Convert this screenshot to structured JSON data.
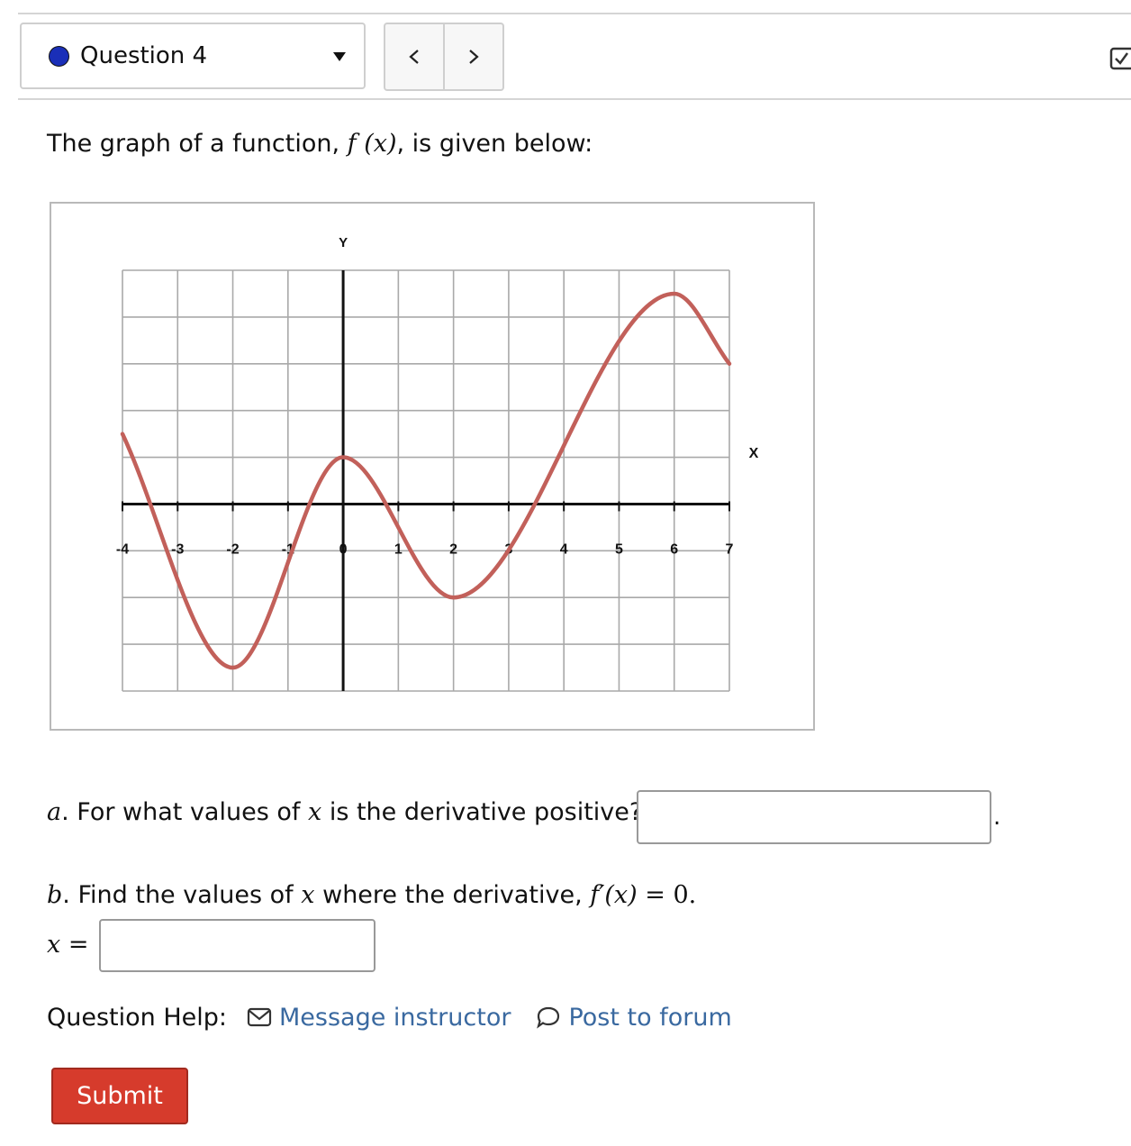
{
  "header": {
    "question_label": "Question 4",
    "status_dot_color": "#1a2fb8",
    "prev_symbol": "<",
    "next_symbol": ">",
    "corner_icon": "checkbox-arrow-icon"
  },
  "intro": {
    "text_before": "The graph of a function,",
    "function_notation": "f (x)",
    "text_after": ", is given below:"
  },
  "chart_data": {
    "type": "line",
    "x_axis_label": "X",
    "y_axis_label": "Y",
    "x_tick_labels": [
      "-4",
      "-3",
      "-2",
      "-1",
      "0",
      "1",
      "2",
      "3",
      "4",
      "5",
      "6",
      "7"
    ],
    "xlim": [
      -4,
      7
    ],
    "ylim": [
      -4,
      5
    ],
    "grid": true,
    "line_color": "#c2605a",
    "series": [
      {
        "x": [
          -4,
          -2,
          0,
          2,
          6,
          7
        ],
        "y": [
          1.5,
          -3.5,
          1,
          -2,
          4.5,
          3
        ]
      }
    ]
  },
  "part_a": {
    "letter": "a",
    "question": ". For what values of",
    "variable": "x",
    "question_end": "is the derivative positive?",
    "input_value": "",
    "trailing_punct": "."
  },
  "part_b": {
    "letter": "b",
    "question": ". Find the values of",
    "variable": "x",
    "question_mid": "where the derivative,",
    "derivative": "f′(x)",
    "equals": "= 0.",
    "answer_prefix_var": "x",
    "answer_prefix_eq": "=",
    "input_value": ""
  },
  "help": {
    "label": "Question Help:",
    "message_label": "Message instructor",
    "forum_label": "Post to forum",
    "link_color": "#3a69a0"
  },
  "submit_label": "Submit",
  "submit_color": "#d63b2c"
}
